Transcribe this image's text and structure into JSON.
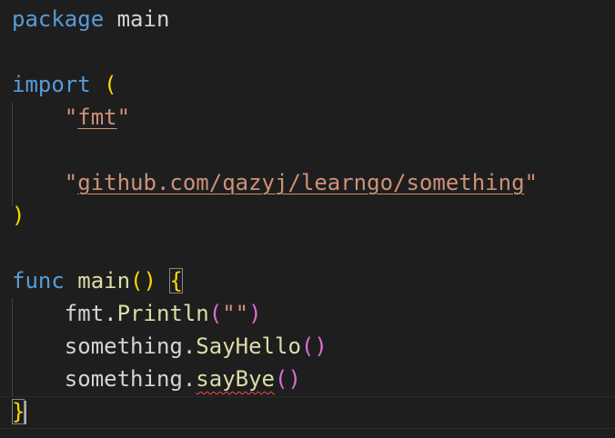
{
  "editor": {
    "lines": [
      {
        "tokens": [
          {
            "text": "package",
            "kind": "keyword"
          },
          {
            "text": " main",
            "kind": "plain"
          }
        ]
      },
      {
        "tokens": []
      },
      {
        "tokens": [
          {
            "text": "import",
            "kind": "keyword"
          },
          {
            "text": " ",
            "kind": "plain"
          },
          {
            "text": "(",
            "kind": "paren-yellow"
          }
        ]
      },
      {
        "tokens": [
          {
            "text": "    ",
            "kind": "plain"
          },
          {
            "text": "\"",
            "kind": "string"
          },
          {
            "text": "fmt",
            "kind": "string",
            "link": true
          },
          {
            "text": "\"",
            "kind": "string"
          }
        ]
      },
      {
        "tokens": []
      },
      {
        "tokens": [
          {
            "text": "    ",
            "kind": "plain"
          },
          {
            "text": "\"",
            "kind": "string"
          },
          {
            "text": "github.com/qazyj/learngo/something",
            "kind": "string",
            "link": true
          },
          {
            "text": "\"",
            "kind": "string"
          }
        ]
      },
      {
        "tokens": [
          {
            "text": ")",
            "kind": "paren-yellow"
          }
        ]
      },
      {
        "tokens": []
      },
      {
        "tokens": [
          {
            "text": "func",
            "kind": "keyword"
          },
          {
            "text": " ",
            "kind": "plain"
          },
          {
            "text": "main",
            "kind": "func"
          },
          {
            "text": "()",
            "kind": "paren-yellow"
          },
          {
            "text": " ",
            "kind": "plain"
          },
          {
            "text": "{",
            "kind": "paren-yellow",
            "match": true
          }
        ]
      },
      {
        "tokens": [
          {
            "text": "    fmt.",
            "kind": "plain"
          },
          {
            "text": "Println",
            "kind": "func"
          },
          {
            "text": "(",
            "kind": "paren-pink"
          },
          {
            "text": "\"\"",
            "kind": "string"
          },
          {
            "text": ")",
            "kind": "paren-pink"
          }
        ]
      },
      {
        "tokens": [
          {
            "text": "    something.",
            "kind": "plain"
          },
          {
            "text": "SayHello",
            "kind": "func"
          },
          {
            "text": "()",
            "kind": "paren-pink"
          }
        ]
      },
      {
        "tokens": [
          {
            "text": "    something.",
            "kind": "plain"
          },
          {
            "text": "sayBye",
            "kind": "func",
            "error": true
          },
          {
            "text": "()",
            "kind": "paren-pink"
          }
        ]
      },
      {
        "tokens": [
          {
            "text": "}",
            "kind": "paren-yellow",
            "match": true
          }
        ]
      }
    ]
  },
  "colors": {
    "background": "#1e1e1e",
    "keyword": "#569cd6",
    "function": "#dcdcaa",
    "string": "#ce9178",
    "bracket_level1": "#ffd700",
    "bracket_level2": "#da70d6",
    "error_squiggle": "#f14c4c"
  }
}
